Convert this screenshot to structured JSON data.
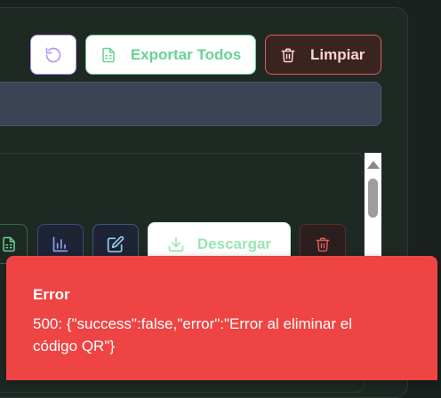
{
  "toolbar": {
    "export_all_label": "Exportar Todos",
    "clear_label": "Limpiar"
  },
  "search": {
    "placeholder": ""
  },
  "item_actions": {
    "download_label": "Descargar"
  },
  "toast": {
    "title": "Error",
    "message": "500: {\"success\":false,\"error\":\"Error al eliminar el código QR\"}"
  },
  "colors": {
    "background": "#1a211e",
    "panel": "#1f2924",
    "refresh_accent": "#b794f4",
    "export_accent": "#68d391",
    "clear_accent": "#e05b5b",
    "toast_error": "#ef4444"
  },
  "icons": {
    "refresh": "refresh-icon",
    "export": "spreadsheet-icon",
    "clear": "trash-icon",
    "sheet": "spreadsheet-icon",
    "chart": "bar-chart-icon",
    "edit": "edit-icon",
    "download": "download-icon",
    "delete": "trash-icon"
  }
}
